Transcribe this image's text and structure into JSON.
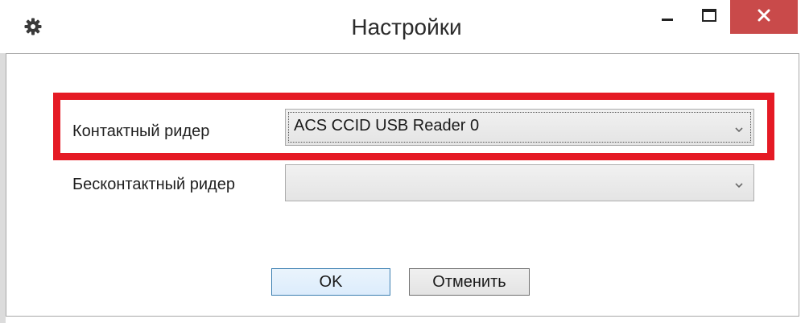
{
  "window": {
    "title": "Настройки",
    "close_color": "#c94a4a"
  },
  "icons": {
    "app": "gear-icon",
    "minimize": "minimize-icon",
    "maximize": "maximize-icon",
    "close": "close-icon",
    "dropdown": "chevron-down-icon"
  },
  "settings": {
    "contact_reader": {
      "label": "Контактный ридер",
      "selected": "ACS CCID USB Reader 0"
    },
    "contactless_reader": {
      "label": "Бесконтактный ридер",
      "selected": ""
    }
  },
  "highlight": {
    "color": "#e51a24"
  },
  "buttons": {
    "ok": "OK",
    "cancel": "Отменить"
  }
}
